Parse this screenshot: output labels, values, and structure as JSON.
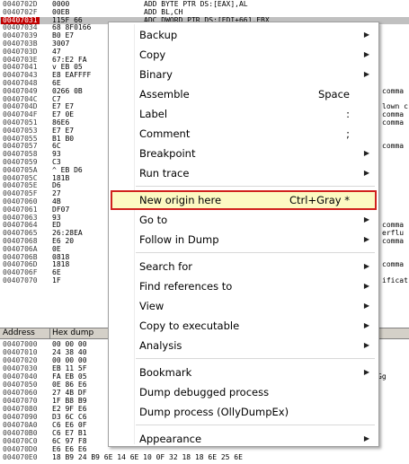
{
  "disasm": {
    "rows": [
      {
        "addr": "0040702D",
        "hex": "0000",
        "asm": "ADD BYTE PTR DS:[EAX],AL"
      },
      {
        "addr": "0040702F",
        "hex": "00EB",
        "asm": "ADD BL,CH"
      },
      {
        "addr": "00407031",
        "hex": "115F 66",
        "asm": "ADC DWORD PTR DS:[EDI+66],EBX",
        "selected": true
      },
      {
        "addr": "00407034",
        "hex": "68 8F0166",
        "asm": ""
      },
      {
        "addr": "00407039",
        "hex": "B0 E7",
        "asm": ""
      },
      {
        "addr": "0040703B",
        "hex": "3007",
        "asm": ""
      },
      {
        "addr": "0040703D",
        "hex": "47",
        "asm": ""
      },
      {
        "addr": "0040703E",
        "hex": "67:E2 FA",
        "asm": ""
      },
      {
        "addr": "00407041",
        "hex": "v EB 05",
        "asm": ""
      },
      {
        "addr": "00407043",
        "hex": "E8 EAFFFF",
        "asm": ""
      },
      {
        "addr": "00407048",
        "hex": "6E",
        "asm": ""
      },
      {
        "addr": "00407049",
        "hex": "0266 0B",
        "asm": ""
      },
      {
        "addr": "0040704C",
        "hex": "C7",
        "asm": ""
      },
      {
        "addr": "0040704D",
        "hex": "E7 E7",
        "asm": ""
      },
      {
        "addr": "0040704F",
        "hex": "E7 0E",
        "asm": ""
      },
      {
        "addr": "00407051",
        "hex": "86E6",
        "asm": ""
      },
      {
        "addr": "00407053",
        "hex": "E7 E7",
        "asm": ""
      },
      {
        "addr": "00407055",
        "hex": "B1 B0",
        "asm": ""
      },
      {
        "addr": "00407057",
        "hex": "6C",
        "asm": ""
      },
      {
        "addr": "00407058",
        "hex": "93",
        "asm": ""
      },
      {
        "addr": "00407059",
        "hex": "C3",
        "asm": ""
      },
      {
        "addr": "0040705A",
        "hex": "^ EB D6",
        "asm": ""
      },
      {
        "addr": "0040705C",
        "hex": "181B",
        "asm": ""
      },
      {
        "addr": "0040705E",
        "hex": "D6",
        "asm": ""
      },
      {
        "addr": "0040705F",
        "hex": "27",
        "asm": ""
      },
      {
        "addr": "00407060",
        "hex": "4B",
        "asm": ""
      },
      {
        "addr": "00407061",
        "hex": "DF07",
        "asm": ""
      },
      {
        "addr": "00407063",
        "hex": "93",
        "asm": ""
      },
      {
        "addr": "00407064",
        "hex": "ED",
        "asm": ""
      },
      {
        "addr": "00407065",
        "hex": "26:28EA",
        "asm": ""
      },
      {
        "addr": "00407068",
        "hex": "E6 20",
        "asm": ""
      },
      {
        "addr": "0040706A",
        "hex": "0E",
        "asm": ""
      },
      {
        "addr": "0040706B",
        "hex": "0818",
        "asm": ""
      },
      {
        "addr": "0040706D",
        "hex": "1818",
        "asm": ""
      },
      {
        "addr": "0040706F",
        "hex": "6E",
        "asm": ""
      },
      {
        "addr": "00407070",
        "hex": "1F",
        "asm": ""
      }
    ],
    "right_comments": [
      {
        "row": 11,
        "text": "comma"
      },
      {
        "row": 13,
        "text": "lown c"
      },
      {
        "row": 14,
        "text": "comma"
      },
      {
        "row": 15,
        "text": "comma"
      },
      {
        "row": 18,
        "text": "comma"
      },
      {
        "row": 28,
        "text": "comma"
      },
      {
        "row": 29,
        "text": "erflu"
      },
      {
        "row": 30,
        "text": "comma"
      },
      {
        "row": 33,
        "text": "comma"
      },
      {
        "row": 35,
        "text": "ificat"
      }
    ]
  },
  "dump": {
    "col_address": "Address",
    "col_hex": "Hex dump",
    "col_ascii": "",
    "rows": [
      {
        "addr": "00407000",
        "hex": "00 00 00",
        "asc": ""
      },
      {
        "addr": "00407010",
        "hex": "24 38 40",
        "asc": ""
      },
      {
        "addr": "00407020",
        "hex": "00 00 00",
        "asc": ""
      },
      {
        "addr": "00407030",
        "hex": "EB 11 5F",
        "asc": ""
      },
      {
        "addr": "00407040",
        "hex": "FA EB 05",
        "asc": "Gg"
      },
      {
        "addr": "00407050",
        "hex": "0E 86 E6",
        "asc": ""
      },
      {
        "addr": "00407060",
        "hex": "27 4B DF",
        "asc": ""
      },
      {
        "addr": "00407070",
        "hex": "1F B8 B9",
        "asc": ""
      },
      {
        "addr": "00407080",
        "hex": "E2 9F E6",
        "asc": ""
      },
      {
        "addr": "00407090",
        "hex": "D3 6C C6",
        "asc": ""
      },
      {
        "addr": "004070A0",
        "hex": "C6 E6 0F",
        "asc": ""
      },
      {
        "addr": "004070B0",
        "hex": "C6 E7 B1",
        "asc": ""
      },
      {
        "addr": "004070C0",
        "hex": "6C 97 F8",
        "asc": ""
      },
      {
        "addr": "004070D0",
        "hex": "E6 E6 E6",
        "asc": ""
      },
      {
        "addr": "004070E0",
        "hex": "18 B9 24 B9 6E 14 6E 10 0F 32 18 18 6E 25 6E",
        "asc": ""
      }
    ]
  },
  "menu": {
    "items": [
      {
        "label": "Backup",
        "shortcut": "",
        "submenu": true
      },
      {
        "label": "Copy",
        "shortcut": "",
        "submenu": true
      },
      {
        "label": "Binary",
        "shortcut": "",
        "submenu": true
      },
      {
        "label": "Assemble",
        "shortcut": "Space",
        "submenu": false
      },
      {
        "label": "Label",
        "shortcut": ":",
        "submenu": false
      },
      {
        "label": "Comment",
        "shortcut": ";",
        "submenu": false
      },
      {
        "label": "Breakpoint",
        "shortcut": "",
        "submenu": true
      },
      {
        "label": "Run trace",
        "shortcut": "",
        "submenu": true
      },
      {
        "separator": true
      },
      {
        "label": "New origin here",
        "shortcut": "Ctrl+Gray *",
        "submenu": false,
        "highlighted": true
      },
      {
        "label": "Go to",
        "shortcut": "",
        "submenu": true
      },
      {
        "label": "Follow in Dump",
        "shortcut": "",
        "submenu": true
      },
      {
        "separator": true
      },
      {
        "label": "Search for",
        "shortcut": "",
        "submenu": true
      },
      {
        "label": "Find references to",
        "shortcut": "",
        "submenu": true
      },
      {
        "label": "View",
        "shortcut": "",
        "submenu": true
      },
      {
        "label": "Copy to executable",
        "shortcut": "",
        "submenu": true
      },
      {
        "label": "Analysis",
        "shortcut": "",
        "submenu": true
      },
      {
        "separator": true
      },
      {
        "label": "Bookmark",
        "shortcut": "",
        "submenu": true
      },
      {
        "label": "Dump debugged process",
        "shortcut": "",
        "submenu": false
      },
      {
        "label": "Dump process (OllyDumpEx)",
        "shortcut": "",
        "submenu": false
      },
      {
        "separator": true
      },
      {
        "label": "Appearance",
        "shortcut": "",
        "submenu": true
      }
    ],
    "arrow_glyph": "▶",
    "highlight_border_color": "#d0211d",
    "highlight_fill_color": "#fcf9c2"
  }
}
